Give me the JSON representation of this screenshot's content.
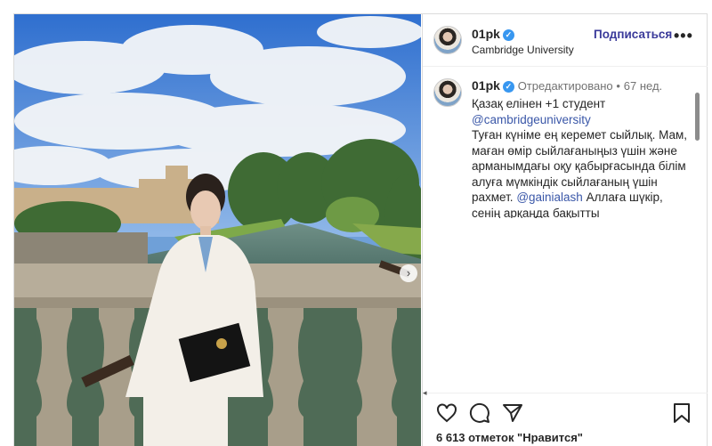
{
  "header": {
    "username": "01pk",
    "location": "Cambridge University",
    "follow_label": "Подписаться",
    "more_label": "•••"
  },
  "caption": {
    "username": "01pk",
    "edited": "Отредактировано",
    "separator": "•",
    "time": "67 нед.",
    "line1": "Қазақ елінен +1 студент",
    "mention1": "@cambridgeuniversity",
    "text1": "Туған күніме ең керемет сыйлық. Мам, маған өмір сыйлағаныңыз үшін және арманымдағы оқу қабырғасында білім алуға мүмкіндік сыйлағаның үшін рахмет.",
    "mention2": "@gainialash",
    "text2": "Аллаға шүкір, сенің арқаңда бақытты"
  },
  "footer": {
    "likes": "6 613 отметок \"Нравится\""
  },
  "icons": {
    "verified": "verified-badge-icon",
    "like": "heart-icon",
    "comment": "comment-icon",
    "share": "send-icon",
    "save": "bookmark-icon",
    "next": "chevron-right-icon"
  },
  "colors": {
    "verified": "#3897f0",
    "follow": "#3a3a9a",
    "link": "#3a57a8"
  }
}
